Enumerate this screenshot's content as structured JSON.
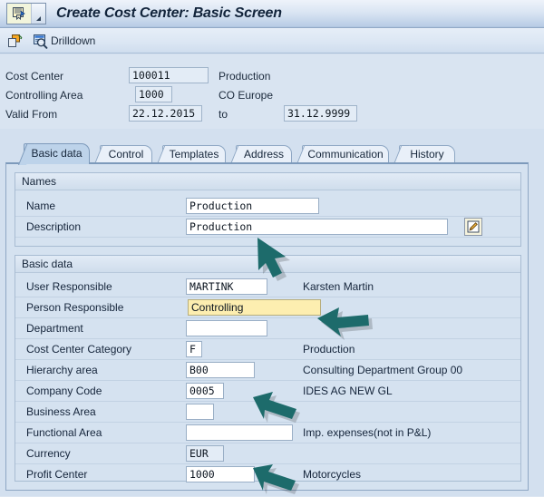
{
  "window": {
    "title": "Create Cost Center: Basic Screen",
    "sysmenu_icon": "sap-menu-icon",
    "sysmenu_caret": "caret-down-left-icon"
  },
  "toolbar": {
    "items": [
      {
        "icon": "copy-object-icon",
        "label": ""
      },
      {
        "icon": "magnifier-drilldown-icon",
        "label": "Drilldown"
      }
    ]
  },
  "header": {
    "rows": [
      {
        "label": "Cost Center",
        "value": "100011",
        "text": "Production"
      },
      {
        "label": "Controlling Area",
        "value": "1000",
        "text": "CO Europe"
      },
      {
        "label": "Valid From",
        "value": "22.12.2015",
        "text": "to",
        "value2": "31.12.9999"
      }
    ]
  },
  "tabs": [
    {
      "label": "Basic data",
      "active": true
    },
    {
      "label": "Control",
      "active": false
    },
    {
      "label": "Templates",
      "active": false
    },
    {
      "label": "Address",
      "active": false
    },
    {
      "label": "Communication",
      "active": false
    },
    {
      "label": "History",
      "active": false
    }
  ],
  "groups": {
    "names": {
      "title": "Names",
      "rows": [
        {
          "label": "Name",
          "value": "Production",
          "text": ""
        },
        {
          "label": "Description",
          "value": "Production",
          "text": ""
        }
      ],
      "edit_icon": "pencil-edit-icon"
    },
    "basic_data": {
      "title": "Basic data",
      "rows": [
        {
          "label": "User Responsible",
          "value": "MARTINK",
          "text": "Karsten Martin"
        },
        {
          "label": "Person Responsible",
          "value": "Controlling",
          "text": ""
        },
        {
          "label": "Department",
          "value": "",
          "text": ""
        },
        {
          "label": "Cost Center Category",
          "value": "F",
          "text": "Production"
        },
        {
          "label": "Hierarchy area",
          "value": "B00",
          "text": "Consulting Department Group 00"
        },
        {
          "label": "Company Code",
          "value": "0005",
          "text": "IDES AG NEW GL"
        },
        {
          "label": "Business Area",
          "value": "",
          "text": ""
        },
        {
          "label": "Functional Area",
          "value": "",
          "text": "Imp. expenses(not in P&L)"
        },
        {
          "label": "Currency",
          "value": "EUR",
          "text": ""
        },
        {
          "label": "Profit Center",
          "value": "1000",
          "text": "Motorcycles"
        }
      ]
    }
  },
  "annotations": {
    "arrow_color": "#1d6b6b",
    "arrows": [
      {
        "name": "arrow-description-field"
      },
      {
        "name": "arrow-person-responsible-field"
      },
      {
        "name": "arrow-company-code-field"
      },
      {
        "name": "arrow-profit-center-field"
      }
    ]
  },
  "colors": {
    "background": "#d3e0ef",
    "panel": "#d5e2f0",
    "titlebar_text": "#12243b",
    "focus_field": "#fdeeb0",
    "focus_marker": "#e02020",
    "arrow": "#1d6b6b"
  }
}
